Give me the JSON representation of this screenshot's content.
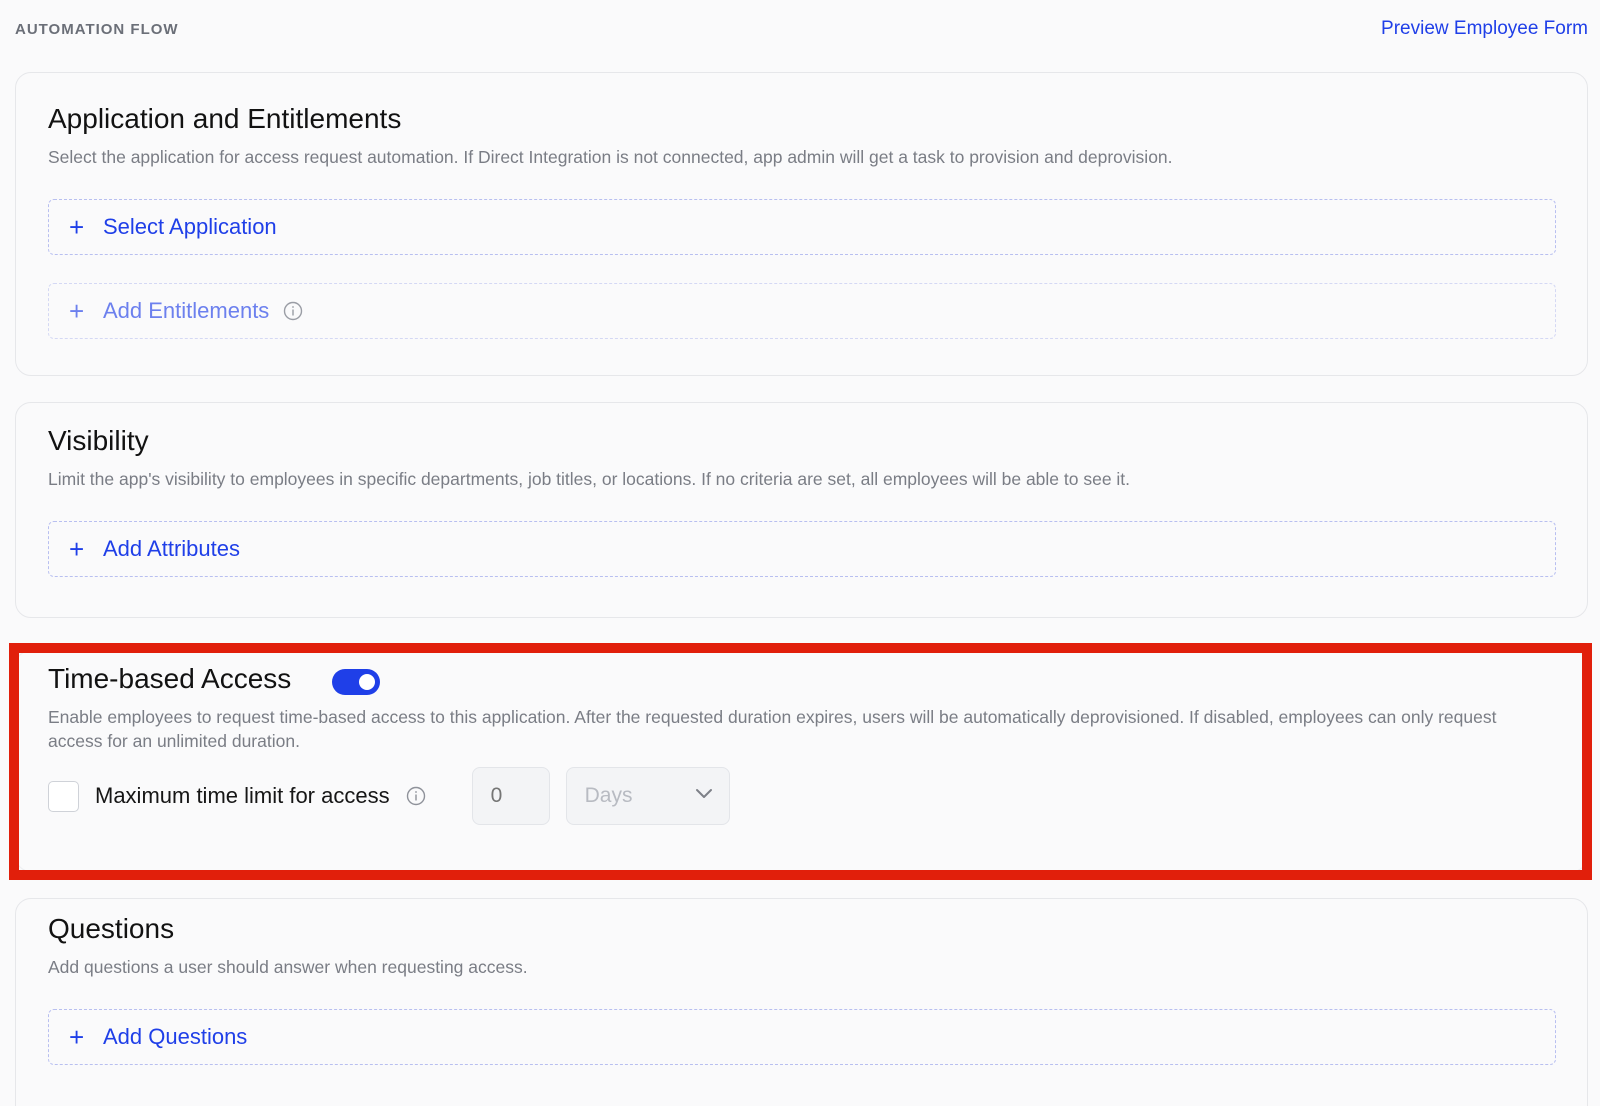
{
  "header": {
    "section_label": "AUTOMATION FLOW",
    "preview_link": "Preview Employee Form"
  },
  "cards": {
    "application": {
      "title": "Application and Entitlements",
      "description": "Select the application for access request automation. If Direct Integration is not connected, app admin will get a task to provision and deprovision.",
      "select_application": "Select Application",
      "add_entitlements": "Add Entitlements"
    },
    "visibility": {
      "title": "Visibility",
      "description": "Limit the app's visibility to employees in specific departments, job titles, or locations. If no criteria are set, all employees will be able to see it.",
      "add_attributes": "Add Attributes"
    },
    "time_based": {
      "title": "Time-based Access",
      "toggle_enabled": true,
      "description": "Enable employees to request time-based access to this application. After the requested duration expires, users will be automatically deprovisioned. If disabled, employees can only request access for an unlimited duration.",
      "limit_label": "Maximum time limit for access",
      "limit_checked": false,
      "limit_value_placeholder": "0",
      "unit_selected": "Days"
    },
    "questions": {
      "title": "Questions",
      "description": "Add questions a user should answer when requesting access.",
      "add_questions": "Add Questions"
    }
  },
  "icons": {
    "plus": "plus-icon",
    "info": "info-icon",
    "chevron": "chevron-down-icon"
  },
  "colors": {
    "accent": "#1f3fe8",
    "highlight_border": "#e11f0b"
  }
}
